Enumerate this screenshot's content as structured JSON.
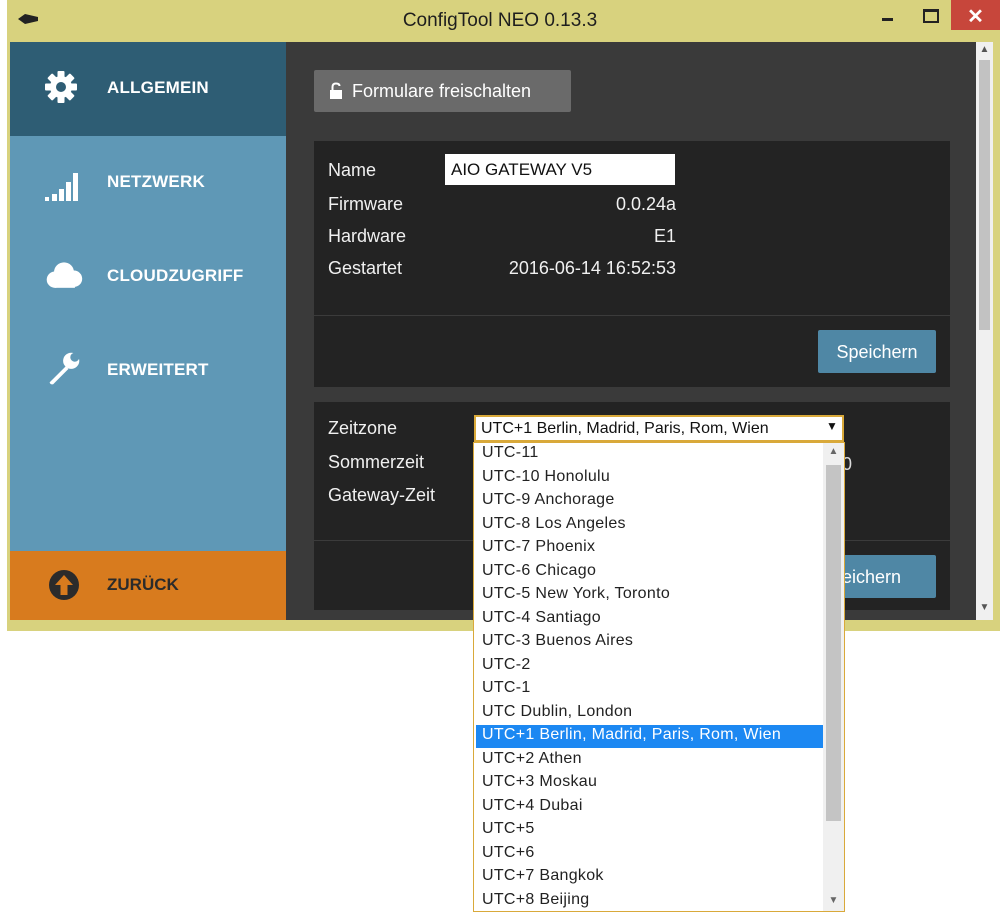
{
  "window": {
    "title": "ConfigTool NEO 0.13.3",
    "close_glyph": "✕",
    "colors": {
      "titlebar": "#d8d27e",
      "close": "#c7463b"
    }
  },
  "sidebar": {
    "items": [
      {
        "label": "ALLGEMEIN",
        "icon": "gear-icon",
        "active": true
      },
      {
        "label": "NETZWERK",
        "icon": "signal-bars-icon",
        "active": false
      },
      {
        "label": "CLOUDZUGRIFF",
        "icon": "cloud-icon",
        "active": false
      },
      {
        "label": "ERWEITERT",
        "icon": "wrench-icon",
        "active": false
      }
    ],
    "back": {
      "label": "ZURÜCK",
      "icon": "arrow-up-circle-icon"
    },
    "colors": {
      "background": "#5f98b6",
      "active": "#2e5d74",
      "back": "#d87b1e"
    }
  },
  "main": {
    "unlock_button": {
      "label": "Formulare freischalten",
      "icon": "lock-open-icon"
    },
    "device_panel": {
      "name_label": "Name",
      "name_value": "AIO GATEWAY V5",
      "rows": [
        {
          "label": "Firmware",
          "value": "0.0.24a"
        },
        {
          "label": "Hardware",
          "value": "E1"
        },
        {
          "label": "Gestartet",
          "value": "2016-06-14 16:52:53"
        }
      ],
      "save_label": "Speichern"
    },
    "time_panel": {
      "rows": [
        {
          "label": "Zeitzone"
        },
        {
          "label": "Sommerzeit"
        },
        {
          "label": "Gateway-Zeit"
        }
      ],
      "partial_value": "0",
      "save_label_partial": "peichern",
      "timezone_selected": "UTC+1  Berlin, Madrid, Paris, Rom, Wien"
    }
  },
  "timezone_dropdown": {
    "selected_index": 12,
    "options": [
      "UTC-11",
      "UTC-10  Honolulu",
      "UTC-9  Anchorage",
      "UTC-8  Los Angeles",
      "UTC-7  Phoenix",
      "UTC-6  Chicago",
      "UTC-5  New York, Toronto",
      "UTC-4  Santiago",
      "UTC-3  Buenos Aires",
      "UTC-2",
      "UTC-1",
      "UTC  Dublin, London",
      "UTC+1  Berlin, Madrid, Paris, Rom, Wien",
      "UTC+2  Athen",
      "UTC+3  Moskau",
      "UTC+4  Dubai",
      "UTC+5",
      "UTC+6",
      "UTC+7  Bangkok",
      "UTC+8  Beijing"
    ],
    "colors": {
      "highlight": "#1c88f2",
      "border": "#d9a93a"
    }
  }
}
